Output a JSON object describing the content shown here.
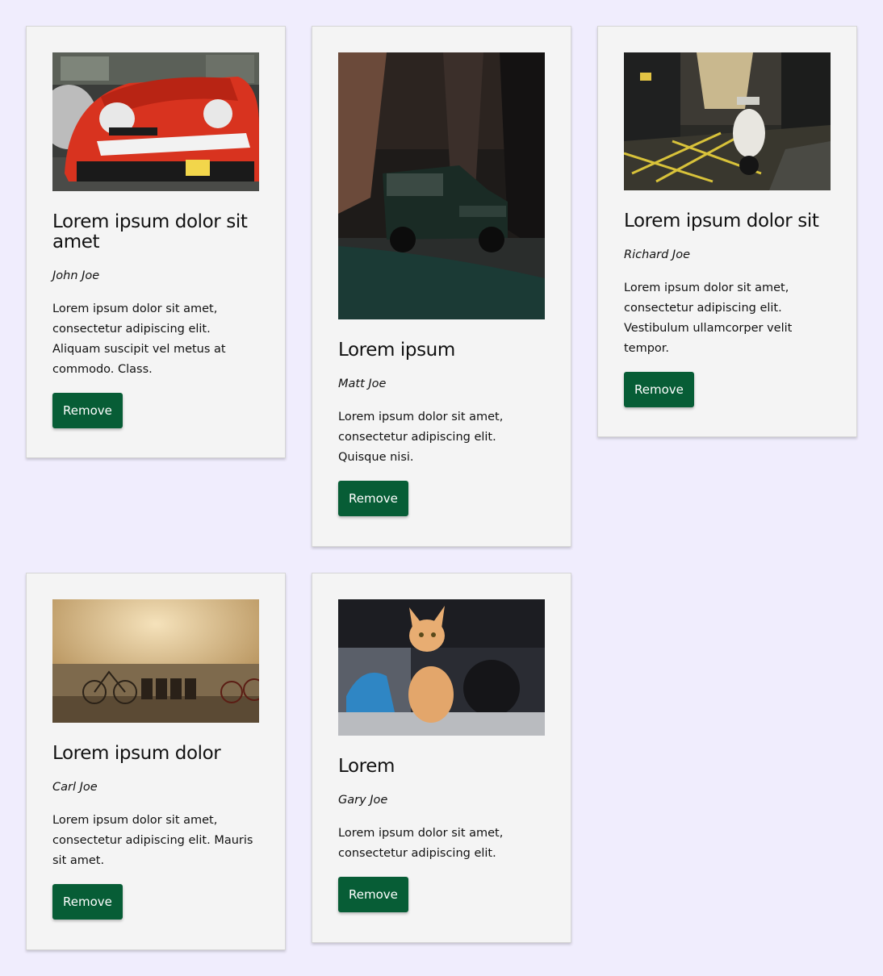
{
  "cards": [
    {
      "title": "Lorem ipsum dolor sit amet",
      "author": "John Joe",
      "description": "Lorem ipsum dolor sit amet, consectetur adipiscing elit. Aliquam suscipit vel metus at commodo. Class.",
      "button_label": "Remove",
      "image": "red-race-car-photo"
    },
    {
      "title": "Lorem ipsum",
      "author": "Matt Joe",
      "description": "Lorem ipsum dolor sit amet, consectetur adipiscing elit. Quisque nisi.",
      "button_label": "Remove",
      "image": "green-offroad-jeep-photo"
    },
    {
      "title": "Lorem ipsum dolor sit",
      "author": "Richard Joe",
      "description": "Lorem ipsum dolor sit amet, consectetur adipiscing elit. Vestibulum ullamcorper velit tempor.",
      "button_label": "Remove",
      "image": "white-scooter-street-photo"
    },
    {
      "title": "Lorem ipsum dolor",
      "author": "Carl Joe",
      "description": "Lorem ipsum dolor sit amet, consectetur adipiscing elit. Mauris sit amet.",
      "button_label": "Remove",
      "image": "bicycles-wall-photo"
    },
    {
      "title": "Lorem",
      "author": "Gary Joe",
      "description": "Lorem ipsum dolor sit amet, consectetur adipiscing elit.",
      "button_label": "Remove",
      "image": "orange-cat-photo"
    }
  ],
  "colors": {
    "page_background": "#f0edfd",
    "card_background": "#f4f4f4",
    "button_background": "#075d36",
    "button_text": "#ffffff"
  }
}
